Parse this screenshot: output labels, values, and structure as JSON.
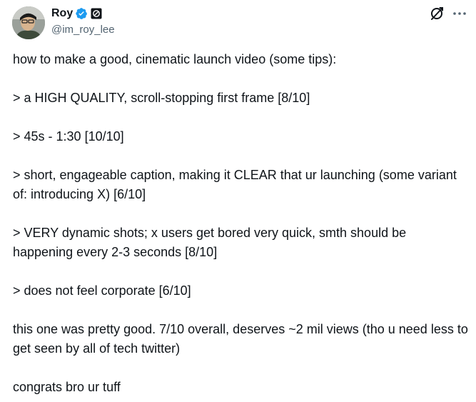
{
  "author": {
    "display_name": "Roy",
    "handle": "@im_roy_lee",
    "verified": true,
    "badge_icon": "affiliate-badge-icon",
    "verified_color": "#1d9bf0"
  },
  "header_actions": {
    "grok_icon": "grok-icon",
    "more_icon": "more-icon"
  },
  "tweet": {
    "paragraphs": [
      "how to make a good, cinematic launch video (some tips):",
      "> a HIGH QUALITY, scroll-stopping first frame [8/10]",
      "> 45s - 1:30 [10/10]",
      "> short, engageable caption, making it CLEAR that ur launching (some variant of: introducing X) [6/10]",
      "> VERY dynamic shots; x users get bored very quick, smth should be happening every 2-3 seconds [8/10]",
      "> does not feel corporate [6/10]",
      "this one was pretty good. 7/10 overall, deserves ~2 mil views (tho u need less to get seen by all of tech twitter)",
      "congrats bro ur tuff"
    ]
  },
  "colors": {
    "text": "#0f1419",
    "secondary": "#536471",
    "accent": "#1d9bf0"
  }
}
